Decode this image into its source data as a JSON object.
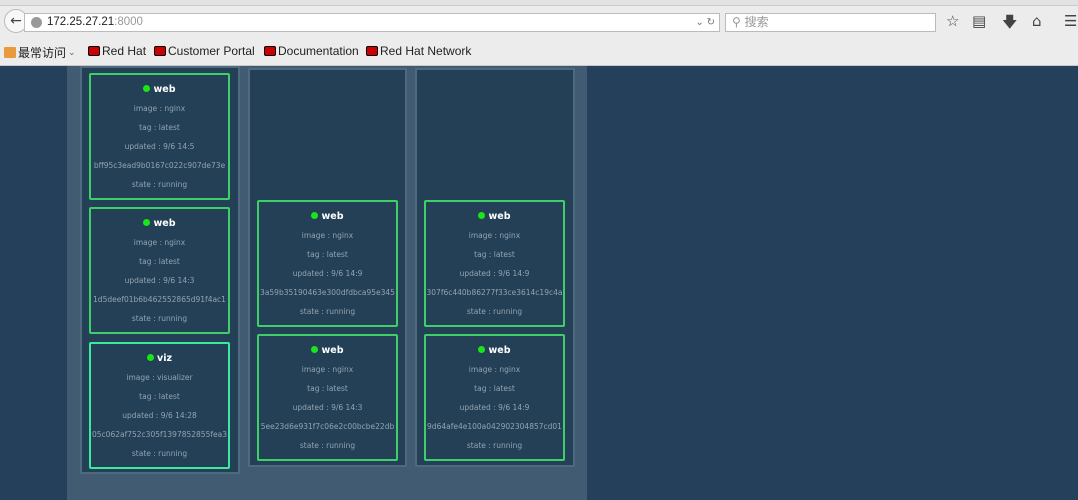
{
  "browser": {
    "url_host": "172.25.27.21",
    "url_port": ":8000",
    "search_placeholder": "搜索",
    "bookmarks": [
      {
        "label": "最常访问",
        "icon": "folder-icon"
      },
      {
        "label": "Red Hat",
        "icon": "redhat-icon"
      },
      {
        "label": "Customer Portal",
        "icon": "redhat-icon"
      },
      {
        "label": "Documentation",
        "icon": "redhat-icon"
      },
      {
        "label": "Red Hat Network",
        "icon": "redhat-icon"
      }
    ]
  },
  "colors": {
    "page_bg": "#24405a",
    "panel_bg": "#415b72",
    "card_border": "#3fcf68",
    "status_dot": "#19e619"
  },
  "columns": [
    {
      "cards": [
        {
          "name": "web",
          "image": "image : nginx",
          "tag": "tag : latest",
          "updated": "updated : 9/6 14:5",
          "id": "bff95c3ead9b0167c022c907de73e",
          "state": "state : running"
        },
        {
          "name": "web",
          "image": "image : nginx",
          "tag": "tag : latest",
          "updated": "updated : 9/6 14:3",
          "id": "1d5deef01b6b462552865d91f4ac1",
          "state": "state : running"
        },
        {
          "name": "viz",
          "image": "image : visualizer",
          "tag": "tag : latest",
          "updated": "updated : 9/6 14:28",
          "id": "05c062af752c305f1397852855fea3",
          "state": "state : running"
        }
      ]
    },
    {
      "cards": [
        {
          "name": "web",
          "image": "image : nginx",
          "tag": "tag : latest",
          "updated": "updated : 9/6 14:9",
          "id": "3a59b35190463e300dfdbca95e345",
          "state": "state : running"
        },
        {
          "name": "web",
          "image": "image : nginx",
          "tag": "tag : latest",
          "updated": "updated : 9/6 14:3",
          "id": "5ee23d6e931f7c06e2c00bcbe22db",
          "state": "state : running"
        }
      ]
    },
    {
      "cards": [
        {
          "name": "web",
          "image": "image : nginx",
          "tag": "tag : latest",
          "updated": "updated : 9/6 14:9",
          "id": "307f6c440b86277f33ce3614c19c4a",
          "state": "state : running"
        },
        {
          "name": "web",
          "image": "image : nginx",
          "tag": "tag : latest",
          "updated": "updated : 9/6 14:9",
          "id": "9d64afe4e100a042902304857cd01",
          "state": "state : running"
        }
      ]
    }
  ]
}
